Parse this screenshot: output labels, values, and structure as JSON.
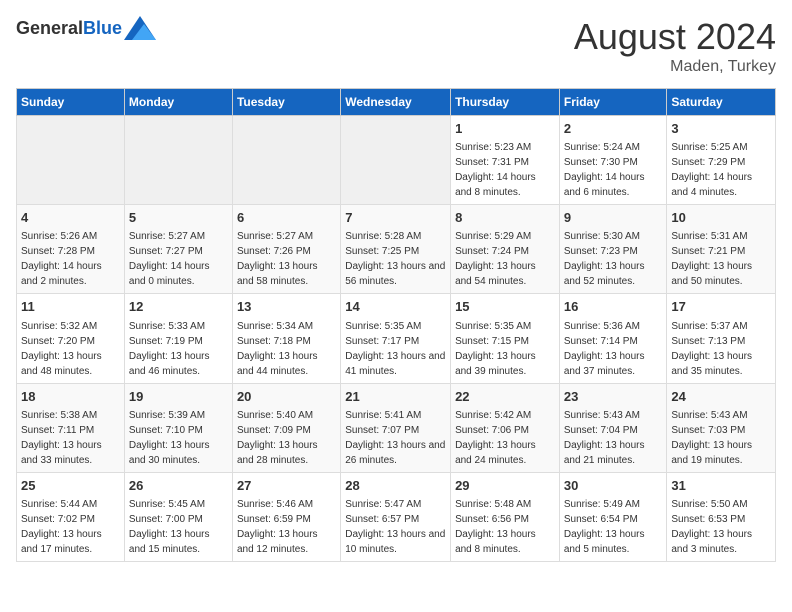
{
  "header": {
    "logo_general": "General",
    "logo_blue": "Blue",
    "month_year": "August 2024",
    "location": "Maden, Turkey"
  },
  "days_of_week": [
    "Sunday",
    "Monday",
    "Tuesday",
    "Wednesday",
    "Thursday",
    "Friday",
    "Saturday"
  ],
  "weeks": [
    [
      {
        "day": "",
        "info": ""
      },
      {
        "day": "",
        "info": ""
      },
      {
        "day": "",
        "info": ""
      },
      {
        "day": "",
        "info": ""
      },
      {
        "day": "1",
        "info": "Sunrise: 5:23 AM\nSunset: 7:31 PM\nDaylight: 14 hours and 8 minutes."
      },
      {
        "day": "2",
        "info": "Sunrise: 5:24 AM\nSunset: 7:30 PM\nDaylight: 14 hours and 6 minutes."
      },
      {
        "day": "3",
        "info": "Sunrise: 5:25 AM\nSunset: 7:29 PM\nDaylight: 14 hours and 4 minutes."
      }
    ],
    [
      {
        "day": "4",
        "info": "Sunrise: 5:26 AM\nSunset: 7:28 PM\nDaylight: 14 hours and 2 minutes."
      },
      {
        "day": "5",
        "info": "Sunrise: 5:27 AM\nSunset: 7:27 PM\nDaylight: 14 hours and 0 minutes."
      },
      {
        "day": "6",
        "info": "Sunrise: 5:27 AM\nSunset: 7:26 PM\nDaylight: 13 hours and 58 minutes."
      },
      {
        "day": "7",
        "info": "Sunrise: 5:28 AM\nSunset: 7:25 PM\nDaylight: 13 hours and 56 minutes."
      },
      {
        "day": "8",
        "info": "Sunrise: 5:29 AM\nSunset: 7:24 PM\nDaylight: 13 hours and 54 minutes."
      },
      {
        "day": "9",
        "info": "Sunrise: 5:30 AM\nSunset: 7:23 PM\nDaylight: 13 hours and 52 minutes."
      },
      {
        "day": "10",
        "info": "Sunrise: 5:31 AM\nSunset: 7:21 PM\nDaylight: 13 hours and 50 minutes."
      }
    ],
    [
      {
        "day": "11",
        "info": "Sunrise: 5:32 AM\nSunset: 7:20 PM\nDaylight: 13 hours and 48 minutes."
      },
      {
        "day": "12",
        "info": "Sunrise: 5:33 AM\nSunset: 7:19 PM\nDaylight: 13 hours and 46 minutes."
      },
      {
        "day": "13",
        "info": "Sunrise: 5:34 AM\nSunset: 7:18 PM\nDaylight: 13 hours and 44 minutes."
      },
      {
        "day": "14",
        "info": "Sunrise: 5:35 AM\nSunset: 7:17 PM\nDaylight: 13 hours and 41 minutes."
      },
      {
        "day": "15",
        "info": "Sunrise: 5:35 AM\nSunset: 7:15 PM\nDaylight: 13 hours and 39 minutes."
      },
      {
        "day": "16",
        "info": "Sunrise: 5:36 AM\nSunset: 7:14 PM\nDaylight: 13 hours and 37 minutes."
      },
      {
        "day": "17",
        "info": "Sunrise: 5:37 AM\nSunset: 7:13 PM\nDaylight: 13 hours and 35 minutes."
      }
    ],
    [
      {
        "day": "18",
        "info": "Sunrise: 5:38 AM\nSunset: 7:11 PM\nDaylight: 13 hours and 33 minutes."
      },
      {
        "day": "19",
        "info": "Sunrise: 5:39 AM\nSunset: 7:10 PM\nDaylight: 13 hours and 30 minutes."
      },
      {
        "day": "20",
        "info": "Sunrise: 5:40 AM\nSunset: 7:09 PM\nDaylight: 13 hours and 28 minutes."
      },
      {
        "day": "21",
        "info": "Sunrise: 5:41 AM\nSunset: 7:07 PM\nDaylight: 13 hours and 26 minutes."
      },
      {
        "day": "22",
        "info": "Sunrise: 5:42 AM\nSunset: 7:06 PM\nDaylight: 13 hours and 24 minutes."
      },
      {
        "day": "23",
        "info": "Sunrise: 5:43 AM\nSunset: 7:04 PM\nDaylight: 13 hours and 21 minutes."
      },
      {
        "day": "24",
        "info": "Sunrise: 5:43 AM\nSunset: 7:03 PM\nDaylight: 13 hours and 19 minutes."
      }
    ],
    [
      {
        "day": "25",
        "info": "Sunrise: 5:44 AM\nSunset: 7:02 PM\nDaylight: 13 hours and 17 minutes."
      },
      {
        "day": "26",
        "info": "Sunrise: 5:45 AM\nSunset: 7:00 PM\nDaylight: 13 hours and 15 minutes."
      },
      {
        "day": "27",
        "info": "Sunrise: 5:46 AM\nSunset: 6:59 PM\nDaylight: 13 hours and 12 minutes."
      },
      {
        "day": "28",
        "info": "Sunrise: 5:47 AM\nSunset: 6:57 PM\nDaylight: 13 hours and 10 minutes."
      },
      {
        "day": "29",
        "info": "Sunrise: 5:48 AM\nSunset: 6:56 PM\nDaylight: 13 hours and 8 minutes."
      },
      {
        "day": "30",
        "info": "Sunrise: 5:49 AM\nSunset: 6:54 PM\nDaylight: 13 hours and 5 minutes."
      },
      {
        "day": "31",
        "info": "Sunrise: 5:50 AM\nSunset: 6:53 PM\nDaylight: 13 hours and 3 minutes."
      }
    ]
  ]
}
